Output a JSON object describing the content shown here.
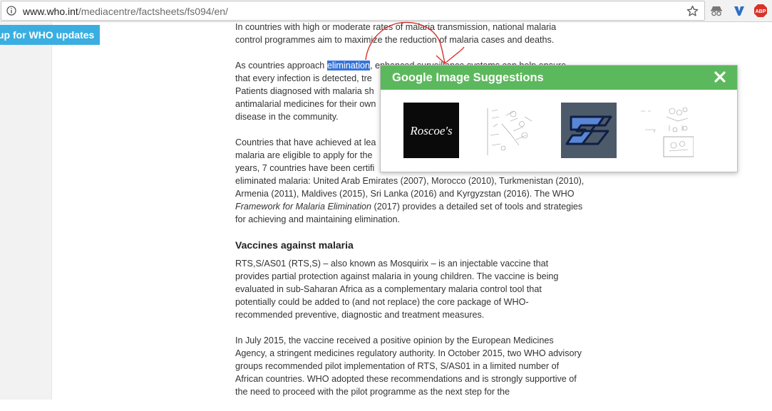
{
  "browser": {
    "url_host": "www.who.int",
    "url_path": "/mediacentre/factsheets/fs094/en/",
    "ext_abp_label": "ABP"
  },
  "page": {
    "signup_label": "up for WHO updates",
    "paragraphs": [
      "In countries with high or moderate rates of malaria transmission, national malaria control programmes aim to maximize the reduction of malaria cases and deaths.",
      "that every infection is detected, tre",
      "Patients diagnosed with malaria sh",
      "antimalarial medicines for their own",
      "disease in the community."
    ],
    "para2_before": "As countries approach ",
    "para2_highlight": "elimination",
    "para2_after": ", enhanced surveillance systems can help ensure",
    "para3_lines": [
      "Countries that have achieved at lea",
      "malaria are eligible to apply for the",
      "years, 7 countries have been certifi"
    ],
    "para3_rest": "eliminated malaria: United Arab Emirates (2007), Morocco (2010), Turkmenistan (2010), Armenia (2011), Maldives (2015), Sri Lanka (2016) and Kyrgyzstan (2016). The WHO ",
    "para3_italic": "Framework for Malaria Elimination",
    "para3_end": " (2017) provides a detailed set of tools and strategies for achieving and maintaining elimination.",
    "heading_vaccines": "Vaccines against malaria",
    "para4": "RTS,S/AS01 (RTS,S) – also known as Mosquirix – is an injectable vaccine that provides partial protection against malaria in young children. The vaccine is being evaluated in sub-Saharan Africa as a complementary malaria control tool that potentially could be added to (and not replace) the core package of WHO-recommended preventive, diagnostic and treatment measures.",
    "para5": "In July 2015, the vaccine received a positive opinion by the European Medicines Agency, a stringent medicines regulatory authority. In October 2015, two WHO advisory groups recommended pilot implementation of RTS, S/AS01 in a limited number of African countries. WHO adopted these recommendations and is strongly supportive of the need to proceed with the pilot programme as the next step for the"
  },
  "popup": {
    "title": "Google Image Suggestions",
    "thumb1_text": "Roscoe's",
    "accent_color": "#5cb85c"
  }
}
